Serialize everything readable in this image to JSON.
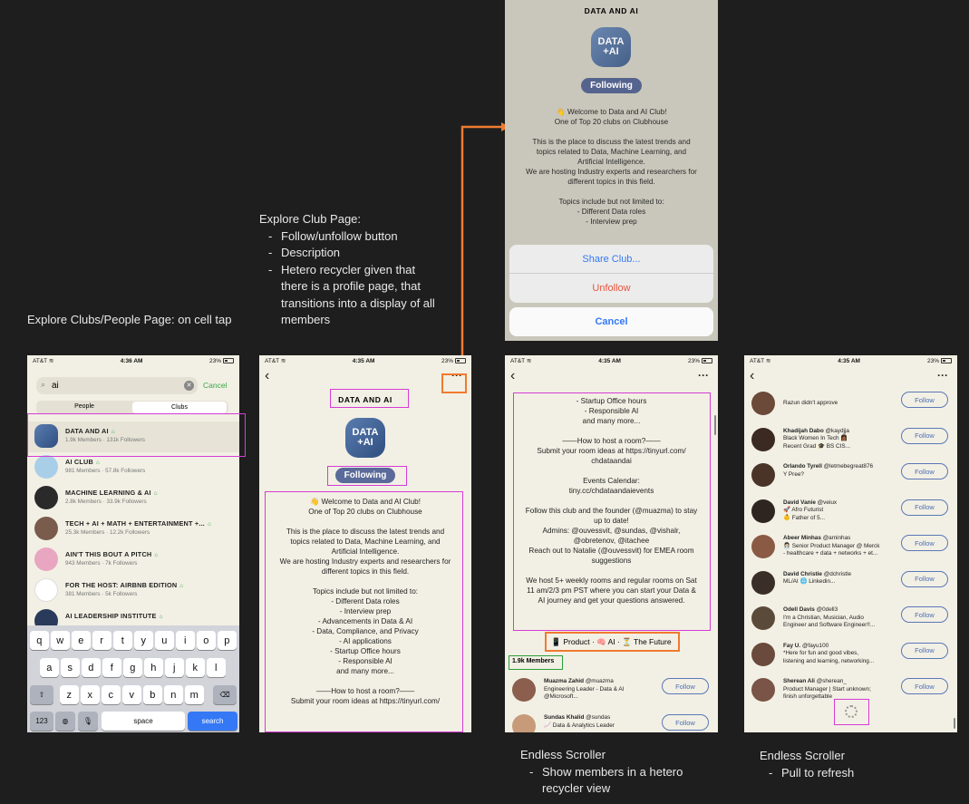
{
  "annotations": {
    "explore_clubs_title": "Explore Clubs/People Page: on cell tap",
    "explore_club_page_title": "Explore Club Page:",
    "explore_club_page_bullets": [
      "Follow/unfollow button",
      "Description",
      "Hetero recycler given that there is a profile page, that transitions into a display of all members"
    ],
    "endless_scroller_1_title": "Endless Scroller",
    "endless_scroller_1_bullet": "Show members in a hetero recycler view",
    "endless_scroller_2_title": "Endless Scroller",
    "endless_scroller_2_bullet": "Pull to refresh"
  },
  "status_bars": {
    "s1": {
      "carrier": "AT&T",
      "time": "4:36 AM",
      "battery": "23%"
    },
    "s2": {
      "carrier": "AT&T",
      "time": "4:35 AM",
      "battery": "23%"
    },
    "s3": {
      "carrier": "AT&T",
      "time": "4:35 AM",
      "battery": "23%"
    },
    "s4": {
      "carrier": "AT&T",
      "time": "4:35 AM",
      "battery": "23%"
    }
  },
  "screen1": {
    "search_value": "ai",
    "cancel": "Cancel",
    "tab_people": "People",
    "tab_clubs": "Clubs",
    "clubs": [
      {
        "name": "DATA AND AI",
        "meta": "1.9k Members · 131k Followers"
      },
      {
        "name": "AI CLUB",
        "meta": "981 Members · 57.8k Followers"
      },
      {
        "name": "MACHINE LEARNING & AI",
        "meta": "2.8k Members · 33.9k Followers"
      },
      {
        "name": "TECH + AI + MATH + ENTERTAINMENT +...",
        "meta": "25.3k Members · 12.2k Followers"
      },
      {
        "name": "AIN'T THIS BOUT A PITCH",
        "meta": "943 Members · 7k Followers"
      },
      {
        "name": "FOR THE HOST: AIRBNB EDITION",
        "meta": "381 Members · 5k Followers"
      },
      {
        "name": "AI LEADERSHIP INSTITUTE",
        "meta": ""
      }
    ],
    "keys_row1": [
      "q",
      "w",
      "e",
      "r",
      "t",
      "y",
      "u",
      "i",
      "o",
      "p"
    ],
    "keys_row2": [
      "a",
      "s",
      "d",
      "f",
      "g",
      "h",
      "j",
      "k",
      "l"
    ],
    "keys_row3": [
      "z",
      "x",
      "c",
      "v",
      "b",
      "n",
      "m"
    ],
    "key_123": "123",
    "key_space": "space",
    "key_search": "search"
  },
  "club": {
    "title": "DATA AND AI",
    "logo_text": "DATA +AI",
    "following": "Following",
    "desc_lines": [
      "👋 Welcome to Data and AI Club!",
      "One of Top 20 clubs on Clubhouse",
      "",
      "This is the place to discuss the latest trends and",
      "topics related to Data, Machine Learning, and",
      "Artificial Intelligence.",
      "We are hosting Industry experts and researchers for",
      "different topics in this field.",
      "",
      "Topics include but not limited to:",
      "- Different Data roles",
      "- Interview prep",
      "- Advancements in Data & AI",
      "- Data, Compliance, and Privacy",
      "- AI applications",
      "- Startup Office hours",
      "- Responsible AI",
      "and many more...",
      "",
      "——How to host a room?——",
      "Submit your room ideas at https://tinyurl.com/"
    ]
  },
  "top_sheet": {
    "title": "DATA AND AI",
    "logo_text": "DATA +AI",
    "following": "Following",
    "desc_lines": [
      "👋 Welcome to Data and AI Club!",
      "One of Top 20 clubs on Clubhouse",
      "",
      "This is the place to discuss the latest trends and",
      "topics related to Data, Machine Learning, and",
      "Artificial Intelligence.",
      "We are hosting Industry experts and researchers for",
      "different topics in this field.",
      "",
      "Topics include but not limited to:",
      "- Different Data roles",
      "- Interview prep"
    ],
    "share": "Share Club...",
    "unfollow": "Unfollow",
    "cancel": "Cancel"
  },
  "screen3": {
    "desc_lines": [
      "- Startup Office hours",
      "- Responsible AI",
      "and many more...",
      "",
      "——How to host a room?——",
      "Submit your room ideas at https://tinyurl.com/",
      "chdataandai",
      "",
      "Events Calendar:",
      "tiny.cc/chdataandaievents",
      "",
      "Follow this club and the founder (@muazma) to stay",
      "up to date!",
      "Admins:  @ouvessvit, @sundas, @vishalr,",
      "@obretenov, @itachee",
      "Reach out to Natalie (@ouvessvit) for EMEA room",
      "suggestions",
      "",
      "We host 5+ weekly rooms and regular rooms on Sat",
      "11 am/2/3 pm PST where you can start your Data &",
      "AI journey and get your questions answered."
    ],
    "tags": "📱 Product · 🧠 AI · ⏳ The Future",
    "members_count": "1.9k Members",
    "members": [
      {
        "name": "Muazma Zahid",
        "handle": "@muazma",
        "bio1": "Engineering Leader - Data & AI",
        "bio2": "@Microsoft...",
        "follow": "Follow"
      },
      {
        "name": "Sundas Khalid",
        "handle": "@sundas",
        "bio1": "📈 Data & Analytics Leader",
        "bio2": "",
        "follow": "Follow"
      }
    ]
  },
  "screen4": {
    "members": [
      {
        "name": "",
        "handle": "",
        "bio1": "Razun didn't approve",
        "bio2": "",
        "bio3": "",
        "follow": "Follow"
      },
      {
        "name": "Khadijah Dabo",
        "handle": "@kaydjja",
        "bio1": "Black Women In Tech 👩🏾",
        "bio2": "Recent Grad 🎓 BS CIS...",
        "bio3": "",
        "follow": "Follow"
      },
      {
        "name": "Orlando Tyrell",
        "handle": "@letmebegreat876",
        "bio1": "Y Pree?",
        "bio2": "",
        "bio3": "",
        "follow": "Follow"
      },
      {
        "name": "David Vanie",
        "handle": "@veiux",
        "bio1": "🚀 Afro Futurist",
        "bio2": "👶 Father of 5...",
        "bio3": "",
        "follow": "Follow"
      },
      {
        "name": "Abeer Minhas",
        "handle": "@aminhas",
        "bio1": "👩🏻‍💼 Senior Product Manager @ Merck",
        "bio2": "- healthcare + data + networks + et...",
        "bio3": "",
        "follow": "Follow"
      },
      {
        "name": "David Christie",
        "handle": "@dchristle",
        "bio1": "ML/AI 🌐 Linkedin...",
        "bio2": "",
        "bio3": "",
        "follow": "Follow"
      },
      {
        "name": "Odell Davis",
        "handle": "@0dell3",
        "bio1": "I'm a Christian, Musician, Audio",
        "bio2": "Engineer and Software Engineer!!...",
        "bio3": "",
        "follow": "Follow"
      },
      {
        "name": "Fay U.",
        "handle": "@fayu100",
        "bio1": "*Here for fun and good vibes,",
        "bio2": "listening and learning, networking...",
        "bio3": "",
        "follow": "Follow"
      },
      {
        "name": "Sherean Ali",
        "handle": "@sherean_",
        "bio1": "Product Manager | Start unknown;",
        "bio2": "finish unforgettable",
        "bio3": "",
        "follow": "Follow"
      }
    ]
  }
}
